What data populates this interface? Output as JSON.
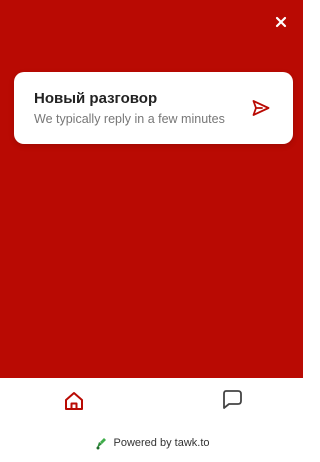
{
  "header": {
    "close_icon": "close-icon"
  },
  "card": {
    "title": "Новый разговор",
    "subtitle": "We typically reply in a few minutes",
    "send_icon": "send-icon"
  },
  "nav": {
    "home_icon": "home-icon",
    "chat_icon": "chat-icon",
    "active": "home"
  },
  "footer": {
    "powered_by": "Powered by tawk.to",
    "logo_icon": "tawk-logo-icon"
  },
  "colors": {
    "brand": "#b90a03",
    "card_bg": "#ffffff",
    "title": "#222222",
    "subtitle": "#777777"
  }
}
